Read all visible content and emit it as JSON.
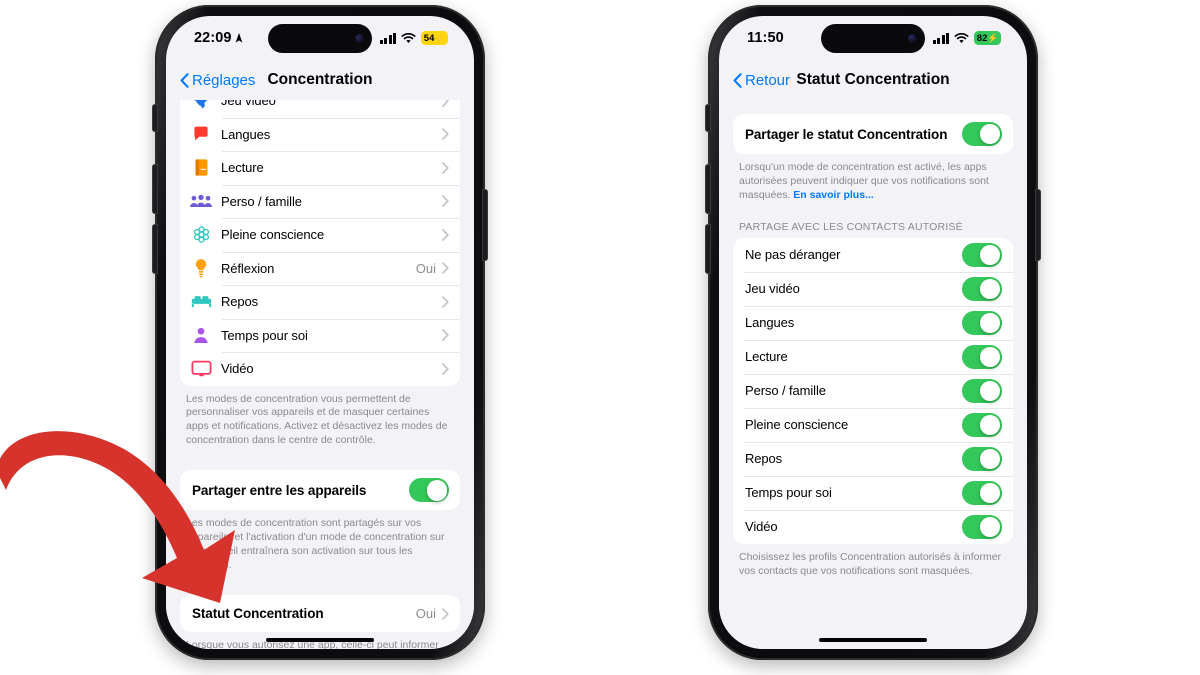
{
  "accent": {
    "blue": "#007aff",
    "green": "#34c759",
    "arrow_red": "#d6332c",
    "gray_text": "#8a8a8e"
  },
  "annotation": {
    "name": "red-curved-arrow",
    "color": "#d6332c",
    "points_to": "Statut Concentration"
  },
  "left_phone": {
    "status_bar": {
      "time": "22:09",
      "location_icon": "location-arrow-icon",
      "signal_icon": "cellular-signal-icon",
      "wifi_icon": "wifi-icon",
      "battery_percent": "54",
      "battery_charging_icon": "bolt-icon",
      "battery_color": "#ffd60a",
      "battery_text_color": "#000000"
    },
    "nav": {
      "back_label": "Réglages",
      "back_icon": "chevron-left-icon",
      "title": "Concentration"
    },
    "modes": [
      {
        "label": "Jeu vidéo",
        "icon": "rocket-icon",
        "value": "",
        "chevron": "chevron-right-icon"
      },
      {
        "label": "Langues",
        "icon": "speech-bubble-icon",
        "value": "",
        "chevron": "chevron-right-icon"
      },
      {
        "label": "Lecture",
        "icon": "book-icon",
        "value": "",
        "chevron": "chevron-right-icon"
      },
      {
        "label": "Perso / famille",
        "icon": "people-group-icon",
        "value": "",
        "chevron": "chevron-right-icon"
      },
      {
        "label": "Pleine conscience",
        "icon": "mindfulness-icon",
        "value": "",
        "chevron": "chevron-right-icon"
      },
      {
        "label": "Réflexion",
        "icon": "lightbulb-icon",
        "value": "Oui",
        "chevron": "chevron-right-icon"
      },
      {
        "label": "Repos",
        "icon": "bed-icon",
        "value": "",
        "chevron": "chevron-right-icon"
      },
      {
        "label": "Temps pour soi",
        "icon": "person-icon",
        "value": "",
        "chevron": "chevron-right-icon"
      },
      {
        "label": "Vidéo",
        "icon": "tv-icon",
        "value": "",
        "chevron": "chevron-right-icon"
      }
    ],
    "modes_footnote": "Les modes de concentration vous permettent de personnaliser vos appareils et de masquer certaines apps et notifications. Activez et désactivez les modes de concentration dans le centre de contrôle.",
    "share_devices": {
      "label": "Partager entre les appareils",
      "toggle_on": true
    },
    "share_devices_footnote": "Les modes de concentration sont partagés sur vos appareils, et l'activation d'un mode de concentration sur un appareil entraînera son activation sur tous les appareils.",
    "focus_status": {
      "label": "Statut Concentration",
      "value": "Oui",
      "chevron": "chevron-right-icon"
    },
    "focus_status_footnote": "Lorsque vous autorisez une app, celle-ci peut informer vos correspondants que vos notifications sont masquées lorsqu'un mode de concentration est activé."
  },
  "right_phone": {
    "status_bar": {
      "time": "11:50",
      "signal_icon": "cellular-signal-icon",
      "wifi_icon": "wifi-icon",
      "battery_percent": "82",
      "battery_charging_icon": "bolt-icon",
      "battery_color": "#34c759",
      "battery_text_color": "#000000"
    },
    "nav": {
      "back_label": "Retour",
      "back_icon": "chevron-left-icon",
      "title": "Statut Concentration"
    },
    "share_status": {
      "label": "Partager le statut Concentration",
      "toggle_on": true
    },
    "share_status_footnote_pre": "Lorsqu'un mode de concentration est activé, les apps autorisées peuvent indiquer que vos notifications sont masquées. ",
    "share_status_footnote_link": "En savoir plus...",
    "section_header": "PARTAGE AVEC LES CONTACTS AUTORISÉ",
    "contacts_modes": [
      {
        "label": "Ne pas déranger",
        "toggle_on": true
      },
      {
        "label": "Jeu vidéo",
        "toggle_on": true
      },
      {
        "label": "Langues",
        "toggle_on": true
      },
      {
        "label": "Lecture",
        "toggle_on": true
      },
      {
        "label": "Perso / famille",
        "toggle_on": true
      },
      {
        "label": "Pleine conscience",
        "toggle_on": true
      },
      {
        "label": "Repos",
        "toggle_on": true
      },
      {
        "label": "Temps pour soi",
        "toggle_on": true
      },
      {
        "label": "Vidéo",
        "toggle_on": true
      }
    ],
    "contacts_footnote": "Choisissez les profils Concentration autorisés à informer vos contacts que vos notifications sont masquées."
  }
}
